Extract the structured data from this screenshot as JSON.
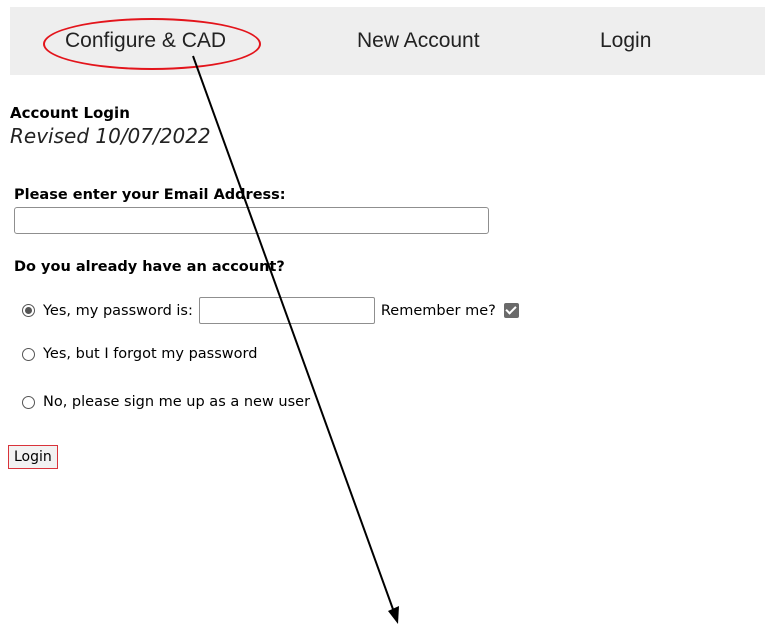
{
  "nav": {
    "items": [
      {
        "label": "Configure & CAD"
      },
      {
        "label": "New Account"
      },
      {
        "label": "Login"
      }
    ]
  },
  "page": {
    "title": "Account Login",
    "revised": "Revised 10/07/2022"
  },
  "form": {
    "email_label": "Please enter your Email Address:",
    "email_value": "",
    "account_question": "Do you already have an account?",
    "options": [
      {
        "label": "Yes, my password is:",
        "checked": true
      },
      {
        "label": "Yes, but I forgot my password",
        "checked": false
      },
      {
        "label": "No, please sign me up as a new user",
        "checked": false
      }
    ],
    "password_value": "",
    "remember_label": "Remember me?",
    "remember_checked": true,
    "login_button": "Login"
  },
  "annotation": {
    "color": "#e3141b",
    "arrow_color": "#000000"
  }
}
